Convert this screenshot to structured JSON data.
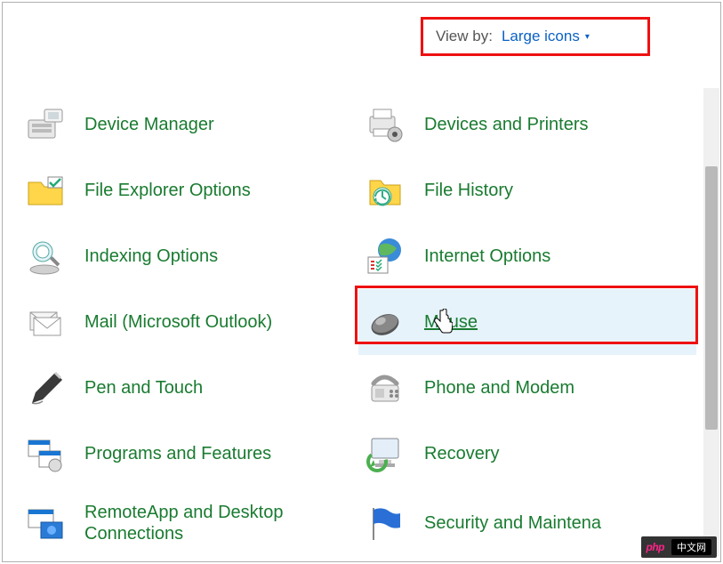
{
  "header": {
    "viewby_label": "View by:",
    "viewby_value": "Large icons"
  },
  "items_left": [
    {
      "id": "device-manager",
      "label": "Device Manager"
    },
    {
      "id": "file-explorer-options",
      "label": "File Explorer Options"
    },
    {
      "id": "indexing-options",
      "label": "Indexing Options"
    },
    {
      "id": "mail",
      "label": "Mail (Microsoft Outlook)"
    },
    {
      "id": "pen-and-touch",
      "label": "Pen and Touch"
    },
    {
      "id": "programs-and-features",
      "label": "Programs and Features"
    },
    {
      "id": "remoteapp",
      "label": "RemoteApp and Desktop Connections"
    }
  ],
  "items_right": [
    {
      "id": "devices-and-printers",
      "label": "Devices and Printers"
    },
    {
      "id": "file-history",
      "label": "File History"
    },
    {
      "id": "internet-options",
      "label": "Internet Options"
    },
    {
      "id": "mouse",
      "label": "Mouse",
      "hovered": true
    },
    {
      "id": "phone-and-modem",
      "label": "Phone and Modem"
    },
    {
      "id": "recovery",
      "label": "Recovery"
    },
    {
      "id": "security-and-maintenance",
      "label": "Security and Maintena"
    }
  ],
  "watermark": {
    "brand": "php",
    "cn": "中文网"
  }
}
